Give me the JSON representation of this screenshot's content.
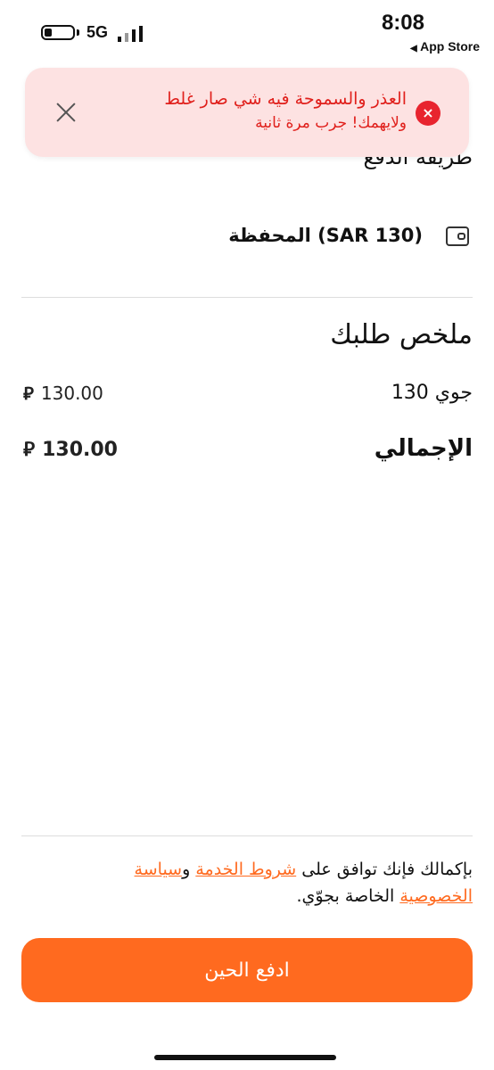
{
  "status_bar": {
    "network": "5G",
    "time": "8:08",
    "back_app": "App Store",
    "back_arrow": "◀"
  },
  "partial_heading": "طريقة الدفع",
  "toast": {
    "line1": "العذر والسموحة فيه شي صار غلط",
    "line2": "ولايهمك! جرب مرة ثانية",
    "icon": "error-icon",
    "icon_glyph": "×",
    "close_icon": "close-icon"
  },
  "payment": {
    "wallet_label": "المحفظة (SAR 130)"
  },
  "summary": {
    "title": "ملخص طلبك",
    "line_item": {
      "label": "جوي 130",
      "amount": "130.00",
      "currency_symbol": "⃁"
    },
    "total": {
      "label": "الإجمالي",
      "amount": "130.00",
      "currency_symbol": "⃁"
    }
  },
  "terms": {
    "prefix": "بإكمالك فإنك توافق على ",
    "tos_link": "شروط الخدمة",
    "and": " و",
    "privacy_link": "سياسة الخصوصية",
    "suffix": " الخاصة بجوّي."
  },
  "pay_button": {
    "label": "ادفع الحين"
  },
  "colors": {
    "accent": "#ff6a1f",
    "toast_bg": "#fde2e2",
    "error": "#e0201c"
  }
}
